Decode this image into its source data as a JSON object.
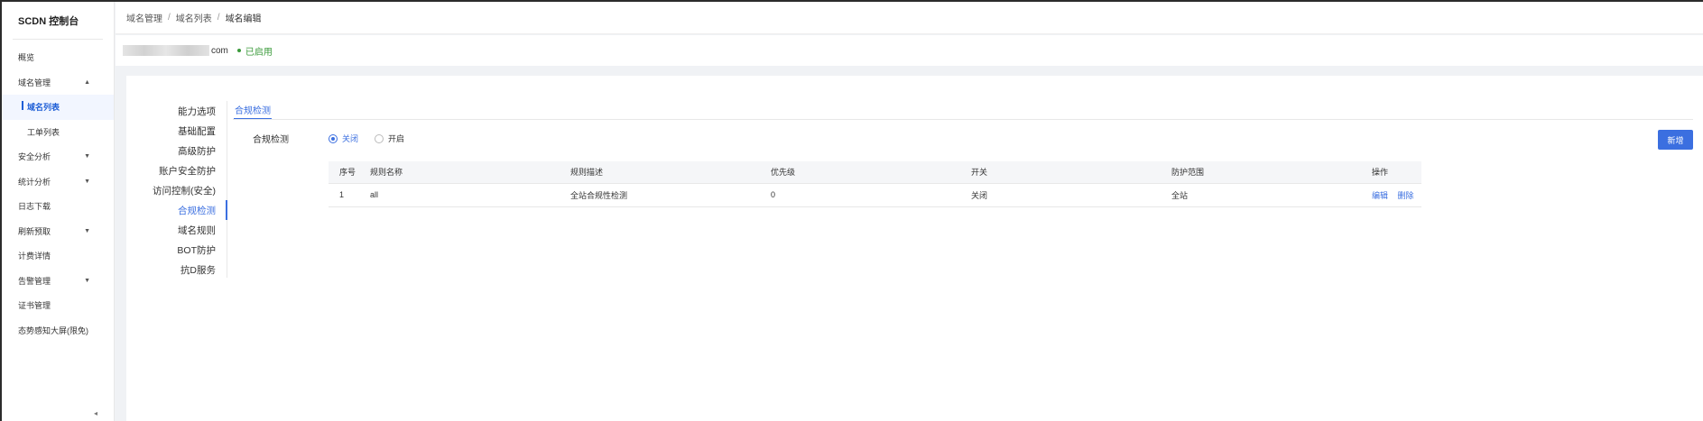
{
  "sidebar": {
    "title": "SCDN 控制台",
    "items": [
      {
        "label": "概览",
        "type": "top",
        "caret": ""
      },
      {
        "label": "域名管理",
        "type": "top",
        "caret": "▲"
      },
      {
        "label": "域名列表",
        "type": "sub-active",
        "caret": ""
      },
      {
        "label": "工单列表",
        "type": "sub",
        "caret": ""
      },
      {
        "label": "安全分析",
        "type": "top",
        "caret": "▼"
      },
      {
        "label": "统计分析",
        "type": "top",
        "caret": "▼"
      },
      {
        "label": "日志下载",
        "type": "top",
        "caret": ""
      },
      {
        "label": "刷新预取",
        "type": "top",
        "caret": "▼"
      },
      {
        "label": "计费详情",
        "type": "top",
        "caret": ""
      },
      {
        "label": "告警管理",
        "type": "top",
        "caret": "▼"
      },
      {
        "label": "证书管理",
        "type": "top",
        "caret": ""
      },
      {
        "label": "态势感知大屏(限免)",
        "type": "top",
        "caret": ""
      }
    ],
    "collapse_glyph": "◂"
  },
  "breadcrumb": [
    "域名管理",
    "域名列表",
    "域名编辑"
  ],
  "domain": {
    "suffix": "com",
    "status": "已启用"
  },
  "sub_nav": [
    {
      "label": "能力选项",
      "active": false
    },
    {
      "label": "基础配置",
      "active": false
    },
    {
      "label": "高级防护",
      "active": false
    },
    {
      "label": "账户安全防护",
      "active": false
    },
    {
      "label": "访问控制(安全)",
      "active": false
    },
    {
      "label": "合规检测",
      "active": true
    },
    {
      "label": "域名规则",
      "active": false
    },
    {
      "label": "BOT防护",
      "active": false
    },
    {
      "label": "抗D服务",
      "active": false
    }
  ],
  "tab": {
    "label": "合规检测"
  },
  "form": {
    "label": "合规检测",
    "options": [
      {
        "label": "关闭",
        "checked": true
      },
      {
        "label": "开启",
        "checked": false
      }
    ],
    "add_button": "新增"
  },
  "table": {
    "columns": [
      "序号",
      "规则名称",
      "规则描述",
      "优先级",
      "开关",
      "防护范围",
      "操作"
    ],
    "rows": [
      {
        "index": "1",
        "name": "all",
        "desc": "全站合规性检测",
        "priority": "0",
        "switch": "关闭",
        "scope": "全站",
        "ops": [
          "编辑",
          "删除"
        ]
      }
    ]
  },
  "colors": {
    "accent": "#3b6fe0",
    "status_green": "#3a9a3a"
  }
}
